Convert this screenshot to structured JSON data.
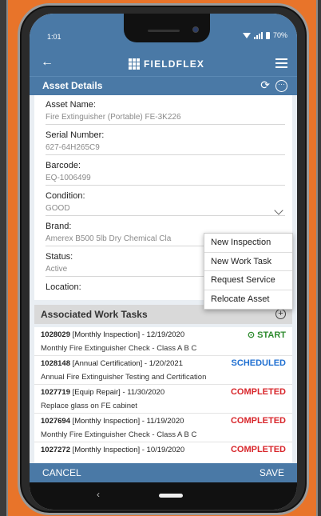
{
  "status_bar": {
    "time": "1:01",
    "battery": "70%"
  },
  "app": {
    "brand": "FIELDFLEX"
  },
  "header": {
    "title": "Asset Details"
  },
  "fields": [
    {
      "label": "Asset Name:",
      "value": "Fire Extinguisher (Portable) FE-3K226"
    },
    {
      "label": "Serial Number:",
      "value": "627-64H265C9"
    },
    {
      "label": "Barcode:",
      "value": "EQ-1006499"
    },
    {
      "label": "Condition:",
      "value": "GOOD"
    },
    {
      "label": "Brand:",
      "value": "Amerex B500 5lb Dry Chemical Cla"
    },
    {
      "label": "Status:",
      "value": "Active"
    },
    {
      "label": "Location:",
      "value": ""
    }
  ],
  "context_menu": {
    "items": [
      "New Inspection",
      "New Work Task",
      "Request Service",
      "Relocate Asset"
    ]
  },
  "work_tasks": {
    "title": "Associated Work Tasks",
    "items": [
      {
        "id": "1028029",
        "info": " [Monthly Inspection] - 12/19/2020",
        "description": "Monthly Fire Extinguisher Check - Class A B C",
        "status": "START",
        "status_color": "#2e8b2e"
      },
      {
        "id": "1028148",
        "info": " [Annual Certification] - 1/20/2021",
        "description": "Annual Fire Extinguisher Testing and Certification",
        "status": "SCHEDULED",
        "status_color": "#1f6fd1"
      },
      {
        "id": "1027719",
        "info": " [Equip Repair] - 11/30/2020",
        "description": "Replace glass on FE cabinet",
        "status": "COMPLETED",
        "status_color": "#d8262b"
      },
      {
        "id": "1027694",
        "info": " [Monthly Inspection] - 11/19/2020",
        "description": "Monthly Fire Extinguisher Check - Class A B C",
        "status": "COMPLETED",
        "status_color": "#d8262b"
      },
      {
        "id": "1027272",
        "info": " [Monthly Inspection] - 10/19/2020",
        "description": "",
        "status": "COMPLETED",
        "status_color": "#d8262b"
      }
    ]
  },
  "footer": {
    "cancel_label": "CANCEL",
    "save_label": "SAVE"
  },
  "colors": {
    "primary": "#4a79a6",
    "background": "#e8742a"
  }
}
